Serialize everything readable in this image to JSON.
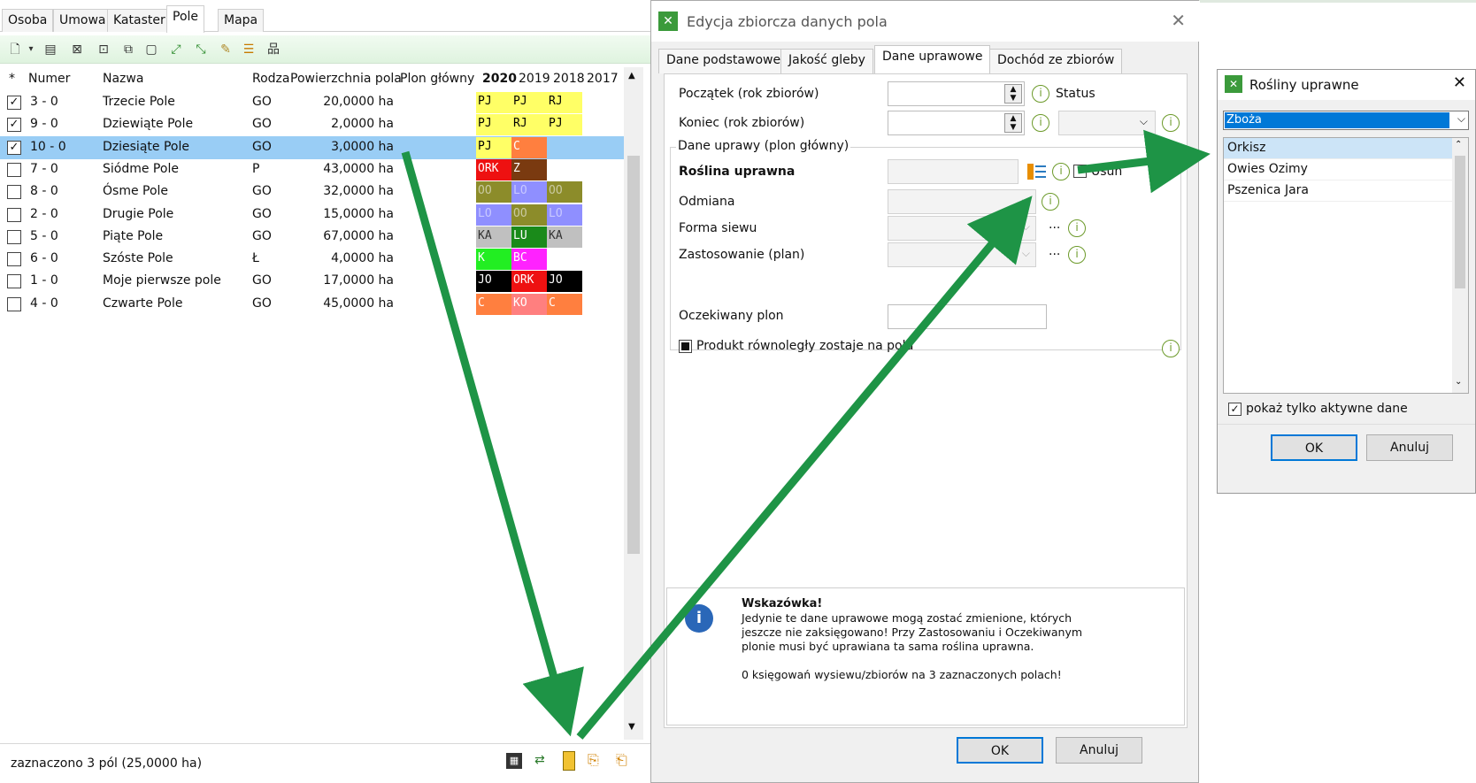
{
  "left_tabs": [
    "Osoba",
    "Umowa",
    "Kataster",
    "Pole",
    "Mapa"
  ],
  "grid": {
    "headers": {
      "star": "*",
      "numer": "Numer",
      "nazwa": "Nazwa",
      "rodzaj": "Rodza",
      "pow": "Powierzchnia pola",
      "plon": "Plon główny",
      "y2020": "2020",
      "y2019": "2019",
      "y2018": "2018",
      "y2017": "2017"
    },
    "rows": [
      {
        "checked": true,
        "numer": "3 - 0",
        "nazwa": "Trzecie Pole",
        "rodzaj": "GO",
        "pow": "20,0000 ha",
        "crops": [
          {
            "t": "PJ",
            "bg": "#ffff66",
            "fg": "#000"
          },
          {
            "t": "PJ",
            "bg": "#ffff66",
            "fg": "#000"
          },
          {
            "t": "RJ",
            "bg": "#ffff66",
            "fg": "#000"
          }
        ]
      },
      {
        "checked": true,
        "numer": "9 - 0",
        "nazwa": "Dziewiąte Pole",
        "rodzaj": "GO",
        "pow": "2,0000 ha",
        "crops": [
          {
            "t": "PJ",
            "bg": "#ffff66",
            "fg": "#000"
          },
          {
            "t": "RJ",
            "bg": "#ffff66",
            "fg": "#000"
          },
          {
            "t": "PJ",
            "bg": "#ffff66",
            "fg": "#000"
          }
        ]
      },
      {
        "checked": true,
        "numer": "10 - 0",
        "nazwa": "Dziesiąte Pole",
        "rodzaj": "GO",
        "pow": "3,0000 ha",
        "crops": [
          {
            "t": "PJ",
            "bg": "#ffff66",
            "fg": "#000"
          },
          {
            "t": "C",
            "bg": "#ff7f3f",
            "fg": "#fff"
          }
        ]
      },
      {
        "checked": false,
        "numer": "7 - 0",
        "nazwa": "Siódme Pole",
        "rodzaj": "P",
        "pow": "43,0000 ha",
        "crops": [
          {
            "t": "ORK",
            "bg": "#ee1111",
            "fg": "#fff"
          },
          {
            "t": "Z",
            "bg": "#7a3a10",
            "fg": "#fff"
          }
        ]
      },
      {
        "checked": false,
        "numer": "8 - 0",
        "nazwa": "Ósme Pole",
        "rodzaj": "GO",
        "pow": "32,0000 ha",
        "crops": [
          {
            "t": "OO",
            "bg": "#8c8c2a",
            "fg": "#c9c9a0"
          },
          {
            "t": "LO",
            "bg": "#8f8fff",
            "fg": "#c8c8ff"
          },
          {
            "t": "OO",
            "bg": "#8c8c2a",
            "fg": "#c9c9a0"
          }
        ]
      },
      {
        "checked": false,
        "numer": "2 - 0",
        "nazwa": "Drugie Pole",
        "rodzaj": "GO",
        "pow": "15,0000 ha",
        "crops": [
          {
            "t": "LO",
            "bg": "#8f8fff",
            "fg": "#c8c8ff"
          },
          {
            "t": "OO",
            "bg": "#8c8c2a",
            "fg": "#c9c9a0"
          },
          {
            "t": "LO",
            "bg": "#8f8fff",
            "fg": "#c8c8ff"
          }
        ]
      },
      {
        "checked": false,
        "numer": "5 - 0",
        "nazwa": "Piąte Pole",
        "rodzaj": "GO",
        "pow": "67,0000 ha",
        "crops": [
          {
            "t": "KA",
            "bg": "#c0c0c0",
            "fg": "#333"
          },
          {
            "t": "LU",
            "bg": "#1a8a1a",
            "fg": "#fff"
          },
          {
            "t": "KA",
            "bg": "#c0c0c0",
            "fg": "#333"
          }
        ]
      },
      {
        "checked": false,
        "numer": "6 - 0",
        "nazwa": "Szóste Pole",
        "rodzaj": "Ł",
        "pow": "4,0000 ha",
        "crops": [
          {
            "t": "K",
            "bg": "#22ee22",
            "fg": "#fff"
          },
          {
            "t": "BC",
            "bg": "#ff22ff",
            "fg": "#fff"
          }
        ]
      },
      {
        "checked": false,
        "numer": "1 - 0",
        "nazwa": "Moje pierwsze pole",
        "rodzaj": "GO",
        "pow": "17,0000 ha",
        "crops": [
          {
            "t": "JO",
            "bg": "#000000",
            "fg": "#fff"
          },
          {
            "t": "ORK",
            "bg": "#ee1111",
            "fg": "#fff"
          },
          {
            "t": "JO",
            "bg": "#000000",
            "fg": "#fff"
          }
        ]
      },
      {
        "checked": false,
        "numer": "4 - 0",
        "nazwa": "Czwarte Pole",
        "rodzaj": "GO",
        "pow": "45,0000 ha",
        "crops": [
          {
            "t": "C",
            "bg": "#ff7f3f",
            "fg": "#fff"
          },
          {
            "t": "KO",
            "bg": "#ff7f7f",
            "fg": "#fff"
          },
          {
            "t": "C",
            "bg": "#ff7f3f",
            "fg": "#fff"
          }
        ]
      }
    ],
    "selected_row": 2
  },
  "status_text": "zaznaczono 3 pól (25,0000 ha)",
  "dialog": {
    "title": "Edycja zbiorcza danych pola",
    "tabs": [
      "Dane podstawowe",
      "Jakość gleby",
      "Dane uprawowe",
      "Dochód ze zbiorów"
    ],
    "active_tab": 2,
    "poczatek_label": "Początek (rok zbiorów)",
    "status_label": "Status",
    "koniec_label": "Koniec (rok zbiorów)",
    "group_title": "Dane uprawy (plon główny)",
    "roslina_label": "Roślina uprawna",
    "usun_label": "Usuń",
    "odmiana_label": "Odmiana",
    "forma_label": "Forma siewu",
    "zastosowanie_label": "Zastosowanie (plan)",
    "oczekiwany_label": "Oczekiwany plon",
    "produkt_label": "Produkt równoległy zostaje na polu",
    "hint_title": "Wskazówka!",
    "hint_lines": [
      "Jedynie te dane uprawowe mogą zostać zmienione, których",
      "jeszcze nie zaksięgowano! Przy Zastosowaniu i Oczekiwanym",
      "plonie musi być uprawiana ta sama roślina uprawna."
    ],
    "hint_footer": "0 księgowań wysiewu/zbiorów na 3 zaznaczonych polach!",
    "ok": "OK",
    "cancel": "Anuluj",
    "dots": "..."
  },
  "crop_dialog": {
    "title": "Rośliny uprawne",
    "category": "Zboża",
    "items": [
      "Orkisz",
      "Owies Ozimy",
      "Pszenica Jara"
    ],
    "selected_item": 0,
    "active_only_label": "pokaż tylko aktywne dane",
    "ok": "OK",
    "cancel": "Anuluj"
  },
  "colors": {
    "selection": "#99cdf5",
    "arrow": "#1e9446",
    "accent": "#0078d7"
  }
}
